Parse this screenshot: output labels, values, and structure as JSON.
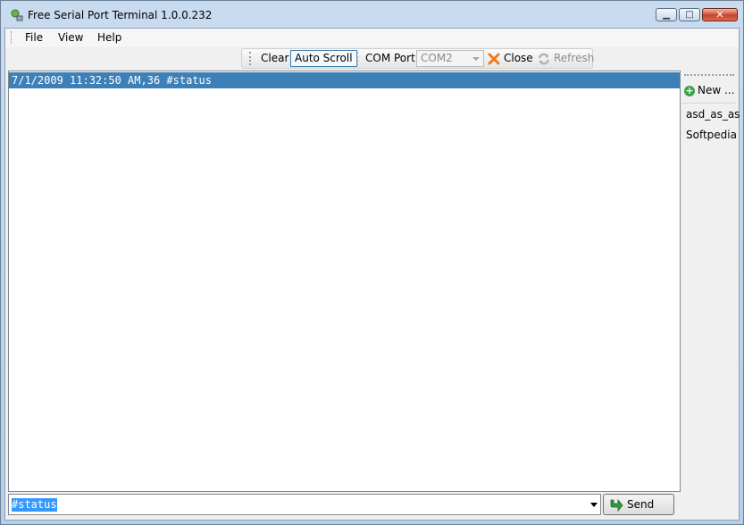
{
  "window": {
    "title": "Free Serial Port Terminal 1.0.0.232"
  },
  "menu": {
    "items": [
      "File",
      "View",
      "Help"
    ]
  },
  "toolbar": {
    "clear_label": "Clear",
    "autoscroll_label": "Auto Scroll",
    "comport_label": "COM Port",
    "comport_value": "COM2",
    "close_label": "Close",
    "refresh_label": "Refresh"
  },
  "output": {
    "lines": [
      "7/1/2009 11:32:50 AM,36 #status"
    ]
  },
  "sidepanel": {
    "new_label": "New ...",
    "items": [
      "asd_as_as",
      "Softpedia"
    ]
  },
  "input": {
    "value": "#status"
  },
  "send": {
    "label": "Send"
  },
  "colors": {
    "selection": "#3d80b8",
    "close_icon": "#f07a1c",
    "send_icon": "#2f9a3a"
  }
}
